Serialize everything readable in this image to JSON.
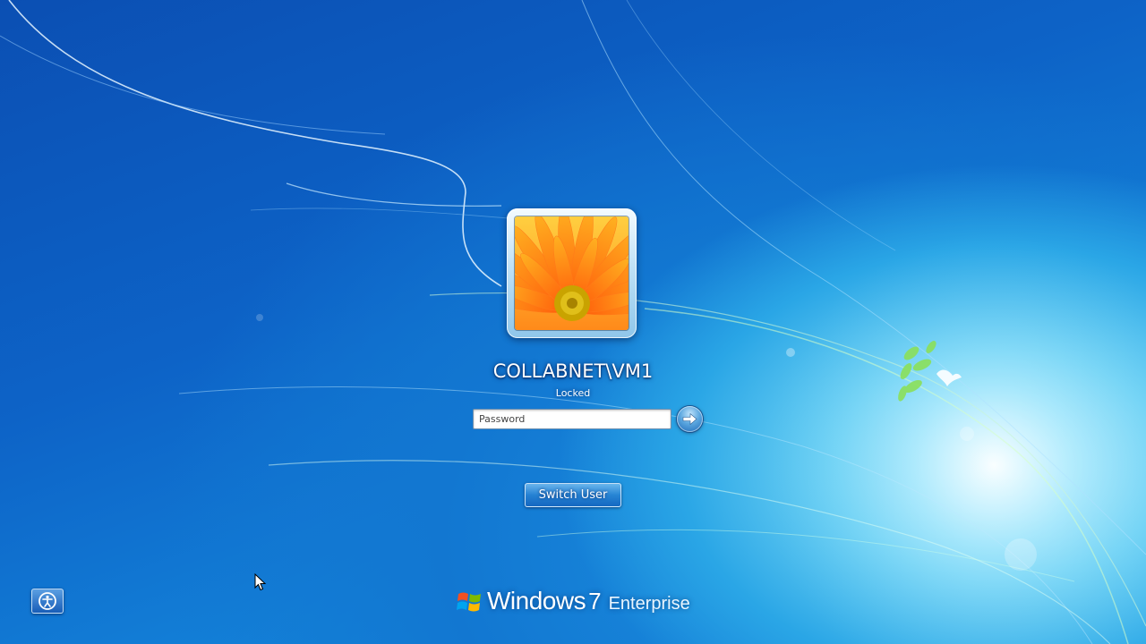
{
  "user": {
    "account_name": "COLLABNET\\VM1",
    "status": "Locked"
  },
  "login": {
    "password_placeholder": "Password",
    "password_value": "",
    "submit_icon": "arrow-right-icon"
  },
  "actions": {
    "switch_user_label": "Switch User",
    "ease_of_access_icon": "ease-of-access-icon"
  },
  "branding": {
    "product": "Windows",
    "version": "7",
    "edition": "Enterprise"
  },
  "colors": {
    "background_dark": "#0b4fb3",
    "background_light": "#6fd3f5",
    "button_blue": "#2a84d4"
  }
}
